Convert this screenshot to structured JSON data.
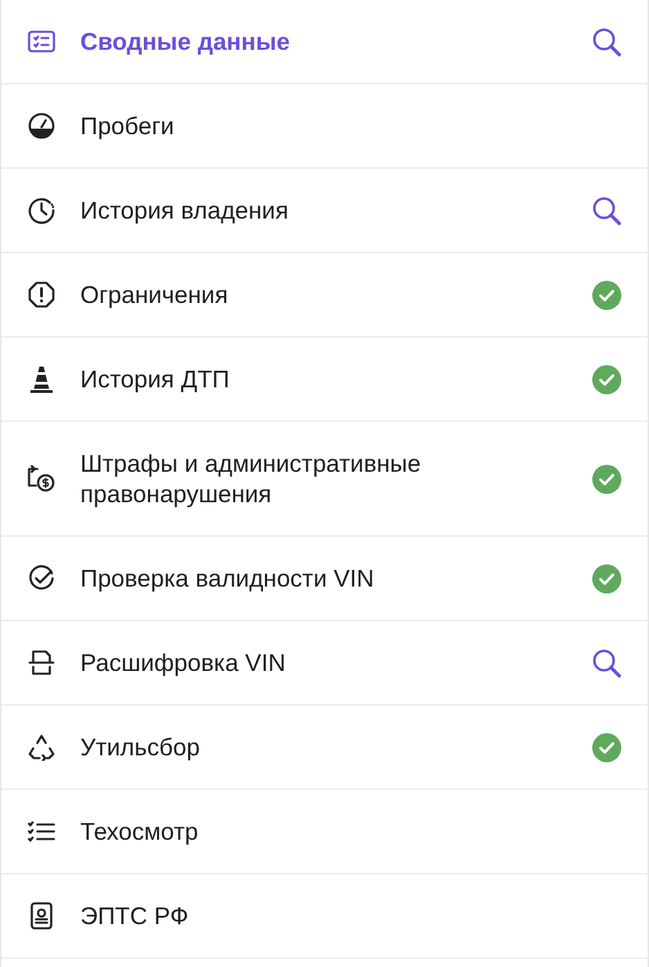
{
  "sections": [
    {
      "label": "Сводные данные",
      "selected": true,
      "kind": "search"
    },
    {
      "label": "Пробеги",
      "selected": false,
      "kind": "plain"
    },
    {
      "label": "История владения",
      "selected": false,
      "kind": "search"
    },
    {
      "label": "Ограничения",
      "selected": false,
      "kind": "done"
    },
    {
      "label": "История ДТП",
      "selected": false,
      "kind": "done"
    },
    {
      "label": "Штрафы и административные правонарушения",
      "selected": false,
      "kind": "done"
    },
    {
      "label": "Проверка валидности VIN",
      "selected": false,
      "kind": "done"
    },
    {
      "label": "Расшифровка VIN",
      "selected": false,
      "kind": "search"
    },
    {
      "label": "Утильсбор",
      "selected": false,
      "kind": "done"
    },
    {
      "label": "Техосмотр",
      "selected": false,
      "kind": "plain"
    },
    {
      "label": "ЭПТС РФ",
      "selected": false,
      "kind": "plain"
    }
  ]
}
